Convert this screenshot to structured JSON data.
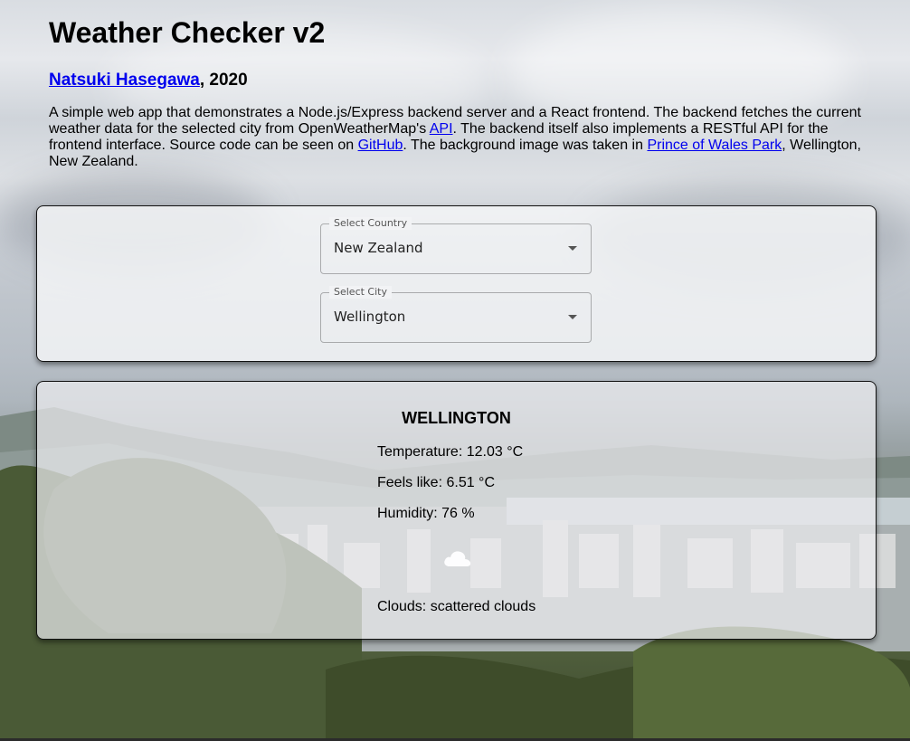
{
  "header": {
    "title": "Weather Checker v2",
    "author_link": "Natsuki Hasegawa",
    "year": ", 2020",
    "description": {
      "part1": "A simple web app that demonstrates a Node.js/Express backend server and a React frontend. The backend fetches the current weather data for the selected city from OpenWeatherMap's ",
      "api_link": "API",
      "part2": ". The backend itself also implements a RESTful API for the frontend interface. Source code can be seen on ",
      "github_link": "GitHub",
      "part3": ". The background image was taken in ",
      "park_link": "Prince of Wales Park",
      "part4": ", Wellington, New Zealand."
    }
  },
  "selectors": {
    "country": {
      "label": "Select Country",
      "value": "New Zealand"
    },
    "city": {
      "label": "Select City",
      "value": "Wellington"
    }
  },
  "weather": {
    "city_name": "WELLINGTON",
    "temperature": "Temperature: 12.03 °C",
    "feels_like": "Feels like: 6.51 °C",
    "humidity": "Humidity: 76 %",
    "clouds": "Clouds: scattered clouds",
    "icon": "cloud-icon"
  },
  "colors": {
    "link": "#0000ee"
  }
}
